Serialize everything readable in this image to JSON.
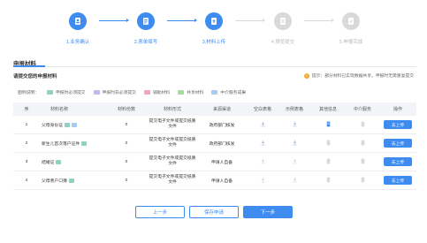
{
  "steps": [
    {
      "label": "1.业务确认",
      "state": "active",
      "icon": "user-doc-icon"
    },
    {
      "label": "2.表单填写",
      "state": "active",
      "icon": "form-icon"
    },
    {
      "label": "3.材料上传",
      "state": "active",
      "icon": "upload-doc-icon"
    },
    {
      "label": "4.预览提交",
      "state": "pending",
      "icon": "preview-icon"
    },
    {
      "label": "5.申报完成",
      "state": "pending",
      "icon": "check-doc-icon"
    }
  ],
  "section": {
    "title": "申报材料",
    "subtitle": "请提交您的申报材料",
    "tip": "提示：部分材料已实现数据共享，申报时无需重复提交"
  },
  "legend": {
    "title": "图例说明：",
    "items": [
      {
        "label": "申报时必须提交",
        "color": "#8fd1c2"
      },
      {
        "label": "申报时非必须提交",
        "color": "#c6b8e6"
      },
      {
        "label": "辅助材料",
        "color": "#f2a5b8"
      },
      {
        "label": "共享材料",
        "color": "#a7dca0"
      },
      {
        "label": "中介服务成果",
        "color": "#a9c9f0"
      }
    ]
  },
  "table": {
    "headers": [
      "序",
      "材料名称",
      "材料份数",
      "材料形式",
      "来源渠道",
      "空白表格",
      "示例表格",
      "其他信息",
      "中介服务",
      "操作"
    ],
    "rows": [
      {
        "no": "1",
        "name": "父母身份证",
        "copies": "0",
        "form": "提交电子文件或提交纸质文件",
        "source": "政府部门核发",
        "action": "去上传"
      },
      {
        "no": "2",
        "name": "新生儿首次落户证件",
        "copies": "0",
        "form": "提交电子文件或提交纸质文件",
        "source": "政府部门核发",
        "action": "去上传"
      },
      {
        "no": "3",
        "name": "结婚证",
        "copies": "0",
        "form": "提交电子文件或提交纸质文件",
        "source": "申请人自备",
        "action": "去上传"
      },
      {
        "no": "4",
        "name": "父母亲户口簿",
        "copies": "0",
        "form": "提交电子文件或提交纸质文件",
        "source": "申请人自备",
        "action": "去上传"
      }
    ]
  },
  "buttons": {
    "prev": "上一步",
    "save": "保存申请",
    "next": "下一步"
  }
}
